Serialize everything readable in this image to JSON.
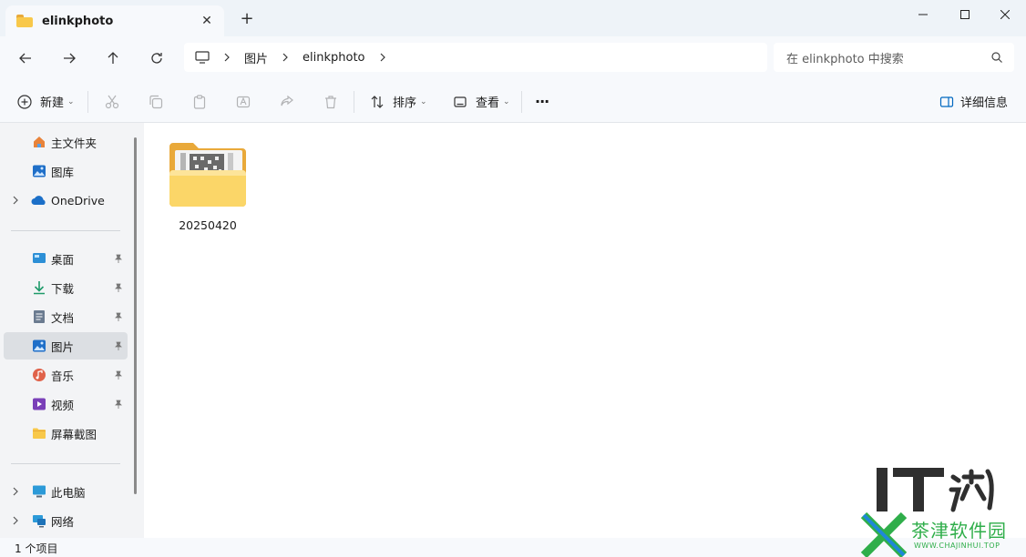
{
  "window": {
    "tab_title": "elinkphoto",
    "close_tab_glyph": "✕",
    "new_tab_glyph": "+"
  },
  "address": {
    "crumbs": [
      "图片",
      "elinkphoto"
    ]
  },
  "search": {
    "placeholder": "在 elinkphoto 中搜索"
  },
  "toolbar": {
    "new_label": "新建",
    "sort_label": "排序",
    "view_label": "查看",
    "more_label": "···",
    "details_label": "详细信息"
  },
  "sidebar": {
    "quick": [
      {
        "label": "主文件夹",
        "icon": "home-icon"
      },
      {
        "label": "图库",
        "icon": "gallery-icon"
      },
      {
        "label": "OneDrive",
        "icon": "cloud-icon"
      }
    ],
    "pinned": [
      {
        "label": "桌面",
        "icon": "desktop-icon"
      },
      {
        "label": "下载",
        "icon": "download-icon"
      },
      {
        "label": "文档",
        "icon": "document-icon"
      },
      {
        "label": "图片",
        "icon": "pictures-icon"
      },
      {
        "label": "音乐",
        "icon": "music-icon"
      },
      {
        "label": "视频",
        "icon": "video-icon"
      },
      {
        "label": "屏幕截图",
        "icon": "folder-icon"
      }
    ],
    "devices": [
      {
        "label": "此电脑",
        "icon": "computer-icon"
      },
      {
        "label": "网络",
        "icon": "network-icon"
      }
    ],
    "selected": "图片"
  },
  "content": {
    "items": [
      {
        "name": "20250420",
        "type": "folder"
      }
    ]
  },
  "status": {
    "text": "1 个项目"
  },
  "watermark": {
    "brand": "茶津软件园",
    "site": "WWW.CHAJINHUI.TOP"
  },
  "colors": {
    "accent": "#0067c0",
    "folder": "#f8c84a",
    "watermark_green": "#2fae4a"
  }
}
